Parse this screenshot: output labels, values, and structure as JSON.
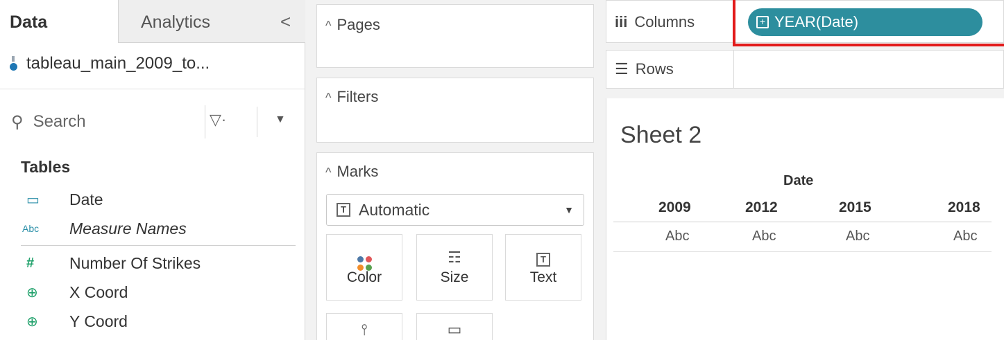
{
  "left_pane": {
    "tab_data": "Data",
    "tab_analytics": "Analytics",
    "collapse_glyph": "<",
    "data_source": "tableau_main_2009_to...",
    "search_placeholder": "Search",
    "filter_glyph": "▽·",
    "dropdown_glyph": "▼",
    "tables_title": "Tables",
    "fields": [
      {
        "icon": "calendar-icon",
        "glyph": "▭",
        "label": "Date"
      },
      {
        "icon": "abc-icon",
        "glyph": "Abc",
        "label": "Measure Names"
      },
      {
        "icon": "measure-icon",
        "glyph": "#",
        "label": "Number Of Strikes"
      },
      {
        "icon": "globe-icon",
        "glyph": "⊕",
        "label": "X Coord"
      },
      {
        "icon": "globe-icon",
        "glyph": "⊕",
        "label": "Y Coord"
      }
    ]
  },
  "shelves": {
    "pages_title": "Pages",
    "filters_title": "Filters",
    "marks_title": "Marks",
    "mark_type": "Automatic",
    "mark_type_glyph": "T",
    "mark_buttons": [
      {
        "label": "Color",
        "icon": "color-dots-icon"
      },
      {
        "label": "Size",
        "icon": "size-icon",
        "glyph": "☶"
      },
      {
        "label": "Text",
        "icon": "text-icon",
        "glyph": "T"
      }
    ],
    "lower_buttons": [
      {
        "icon": "detail-icon",
        "glyph": "⫯"
      },
      {
        "icon": "tooltip-icon",
        "glyph": "▭"
      }
    ]
  },
  "canvas": {
    "columns_label": "Columns",
    "columns_glyph": "iii",
    "rows_label": "Rows",
    "rows_glyph": "☰",
    "column_pill": "YEAR(Date)",
    "pill_glyph": "+",
    "sheet_title": "Sheet 2",
    "header": "Date",
    "years": [
      "2009",
      "2012",
      "2015",
      "2018"
    ],
    "cells": [
      "Abc",
      "Abc",
      "Abc",
      "Abc"
    ]
  },
  "colors": {
    "pill": "#2d8e9e",
    "highlight": "#e21b1b",
    "dot_colors": [
      "#4e79a7",
      "#e15759",
      "#f28e2b",
      "#59a14f"
    ]
  }
}
